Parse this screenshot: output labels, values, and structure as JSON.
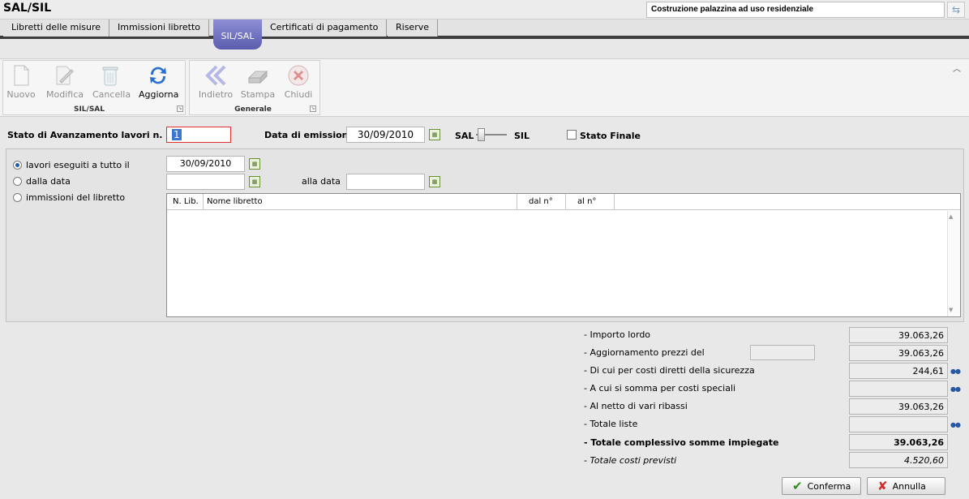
{
  "app": {
    "title": "SAL/SIL",
    "project": "Costruzione palazzina ad uso residenziale"
  },
  "tabs": [
    "Libretti delle misure",
    "Immissioni libretto",
    "SIL/SAL",
    "Certificati di pagamento",
    "Riserve"
  ],
  "ribbon": {
    "group1": {
      "label": "SIL/SAL",
      "buttons": [
        "Nuovo",
        "Modifica",
        "Cancella",
        "Aggiorna"
      ]
    },
    "group2": {
      "label": "Generale",
      "buttons": [
        "Indietro",
        "Stampa",
        "Chiudi"
      ]
    }
  },
  "form": {
    "sal_label": "Stato di Avanzamento lavori n.",
    "sal_number": "1",
    "data_emissione_label": "Data di emissione",
    "data_emissione": "30/09/2010",
    "toggle_left": "SAL",
    "toggle_right": "SIL",
    "stato_finale_label": "Stato Finale",
    "stato_finale_checked": false
  },
  "filter": {
    "option1": "lavori eseguiti a tutto il",
    "option1_date": "30/09/2010",
    "option2": "dalla data",
    "option2_date": "",
    "alla_data_label": "alla data",
    "alla_data": "",
    "option3": "immissioni del libretto",
    "selected": "option1"
  },
  "grid": {
    "columns": [
      "N. Lib.",
      "Nome libretto",
      "dal n°",
      "al n°"
    ],
    "rows": []
  },
  "totals": {
    "importo_lordo": {
      "label": "- Importo lordo",
      "value": "39.063,26"
    },
    "aggiornamento": {
      "label": "- Aggiornamento prezzi del",
      "extra": "",
      "value": "39.063,26"
    },
    "sicurezza": {
      "label": "- Di cui per costi diretti della sicurezza",
      "value": "244,61"
    },
    "speciali": {
      "label": "- A cui si somma per costi speciali",
      "value": ""
    },
    "ribassi": {
      "label": "- Al netto di vari ribassi",
      "value": "39.063,26"
    },
    "liste": {
      "label": "- Totale liste",
      "value": ""
    },
    "complessivo": {
      "label": "- Totale complessivo somme impiegate",
      "value": "39.063,26"
    },
    "previsti": {
      "label": "- Totale costi previsti",
      "value": "4.520,60"
    }
  },
  "buttons": {
    "confirm": "Conferma",
    "cancel": "Annulla"
  }
}
